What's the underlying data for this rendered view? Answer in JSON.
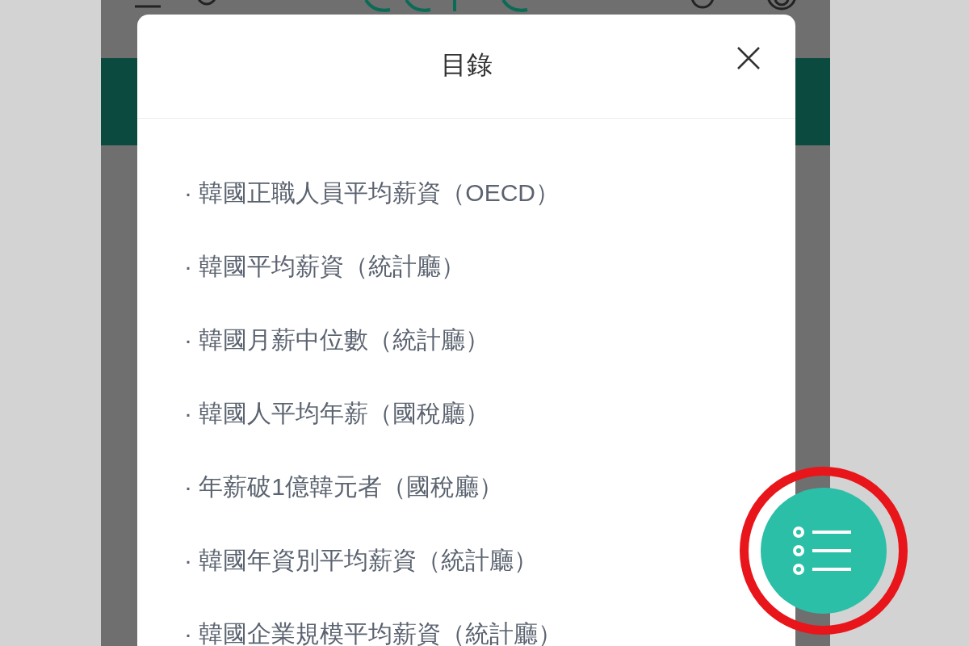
{
  "dialog": {
    "title": "目錄",
    "items": [
      {
        "label": "· 韓國正職人員平均薪資（OECD）"
      },
      {
        "label": "· 韓國平均薪資（統計廳）"
      },
      {
        "label": "· 韓國月薪中位數（統計廳）"
      },
      {
        "label": "· 韓國人平均年薪（國稅廳）"
      },
      {
        "label": "· 年薪破1億韓元者（國稅廳）"
      },
      {
        "label": "· 韓國年資別平均薪資（統計廳）"
      },
      {
        "label": "· 韓國企業規模平均薪資（統計廳）"
      }
    ]
  }
}
